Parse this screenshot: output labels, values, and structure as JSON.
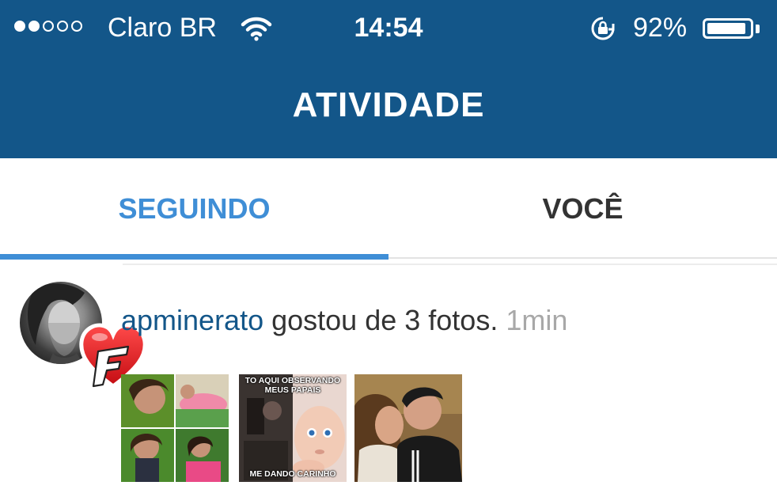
{
  "status_bar": {
    "signal_filled": 2,
    "signal_total": 5,
    "carrier": "Claro BR",
    "time": "14:54",
    "battery_percent": "92%",
    "battery_level": 0.92
  },
  "header": {
    "title": "ATIVIDADE"
  },
  "tabs": [
    {
      "label": "SEGUINDO",
      "active": true
    },
    {
      "label": "VOCÊ",
      "active": false
    }
  ],
  "activity": {
    "username": "apminerato",
    "action": " gostou de 3 fotos.",
    "time_ago": " 1min",
    "thumbnails": [
      {
        "caption_top": "",
        "caption_bottom": ""
      },
      {
        "caption_top": "TO AQUI OBSERVANDO MEUS PAPAIS",
        "caption_bottom": "ME DANDO CARINHO"
      },
      {
        "caption_top": "",
        "caption_bottom": ""
      }
    ]
  },
  "colors": {
    "header_bg": "#135689",
    "tab_active": "#3f8ed6",
    "username": "#135689",
    "time_ago": "#a8a8a8"
  }
}
